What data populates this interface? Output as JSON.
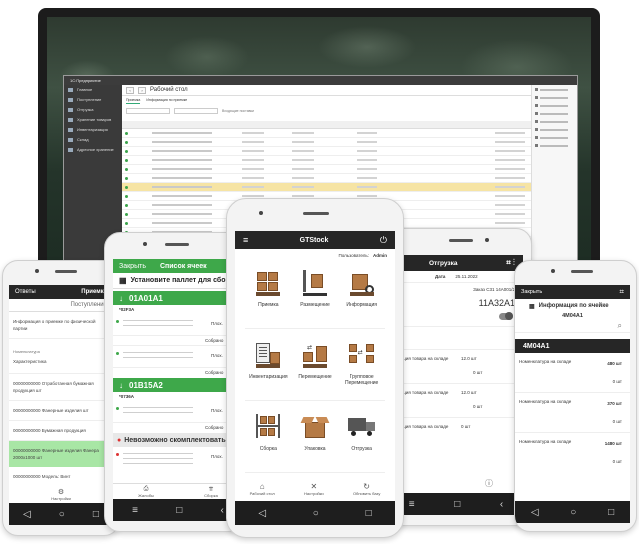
{
  "desktop": {
    "window_title": "1С:Предприятие",
    "page_title": "Рабочий стол",
    "tabs": [
      "Приемка",
      "Информация по приемке"
    ],
    "filter_label": "Входящие поставки",
    "sidebar": [
      "Главное",
      "Поступление",
      "Отгрузка",
      "Хранение товаров",
      "Инвентаризация",
      "Склад",
      "Адресное хранение"
    ],
    "right_panel": [
      "Ввести складку",
      "Приемка",
      "Заказы",
      "Инвентаризация",
      "Размещение",
      "Упаковка",
      "Отгрузка",
      "Отгрузка складки"
    ],
    "grid_rows": 14,
    "highlight_row": 6
  },
  "phone_left": {
    "header_left": "Ответы",
    "header_right": "Приемка",
    "tab": "Поступление",
    "note": "Информация о приемке по физической партии",
    "section": "Номенклатура",
    "items": [
      "Характеристика",
      "00000000000 Отработанная бумажная продукция шт",
      "00000000000 Фанерные изделия шт",
      "00000000000 Бумажная продукция",
      "00000000000 Фанерные изделия Фанера 2000х1000 шт",
      "00000000000 Модель: Винт"
    ],
    "bottom": "Настройки"
  },
  "phone_mid_left": {
    "header_left": "Закрыть",
    "header_right": "Список ячеек",
    "banner": "Установите паллет для сбора",
    "cell1": "01A01A1",
    "cell1_sub": "*02F3A",
    "cell2": "01B15A2",
    "cell2_sub": "*0736A",
    "row_label": "Плох.",
    "row_label2": "Собрано",
    "alert": "Невозможно скомплектовать",
    "bottom_left": "Жалобы",
    "bottom_right": "Сборка"
  },
  "phone_center": {
    "app_title": "GTStock",
    "user_label": "Пользователь:",
    "user": "Admin",
    "tiles": [
      {
        "label": "Приемка",
        "icon": "boxes-icon"
      },
      {
        "label": "Размещение",
        "icon": "pallet-jack-icon"
      },
      {
        "label": "Информация",
        "icon": "box-search-icon"
      },
      {
        "label": "Инвентаризация",
        "icon": "clipboard-icon"
      },
      {
        "label": "Перемещение",
        "icon": "move-boxes-icon"
      },
      {
        "label": "Групповое Перемещение",
        "icon": "group-move-icon"
      },
      {
        "label": "Сборка",
        "icon": "shelves-icon"
      },
      {
        "label": "Упаковка",
        "icon": "open-box-icon"
      },
      {
        "label": "Отгрузка",
        "icon": "truck-icon"
      }
    ],
    "bottom": [
      "Рабочий стол",
      "Настройки",
      "Обновить базу"
    ]
  },
  "phone_mid_right": {
    "header": "Отгрузка",
    "date_label": "Дата",
    "date_value": "25.11.2022",
    "order": "Заказ С31 14А001/2",
    "code": "11A32A1",
    "items": [
      {
        "name": "Позиция товара на складе",
        "qty": "12.0 шт"
      },
      {
        "name": "Позиция товара на складе",
        "qty": "12.0 шт"
      },
      {
        "name": "Позиция товара на складе",
        "qty": "0 шт"
      }
    ]
  },
  "phone_right": {
    "header_left": "Закрыть",
    "title": "Информация по ячейке",
    "cell": "4M04A1",
    "cell_big": "4M04A1",
    "items": [
      {
        "name": "Номенклатура на складе",
        "qty": "480 шт"
      },
      {
        "name": "Номенклатура на складе",
        "qty": "370 шт"
      },
      {
        "name": "Номенклатура на складе",
        "qty": "1480 шт"
      }
    ],
    "qty_zero": "0 шт"
  }
}
